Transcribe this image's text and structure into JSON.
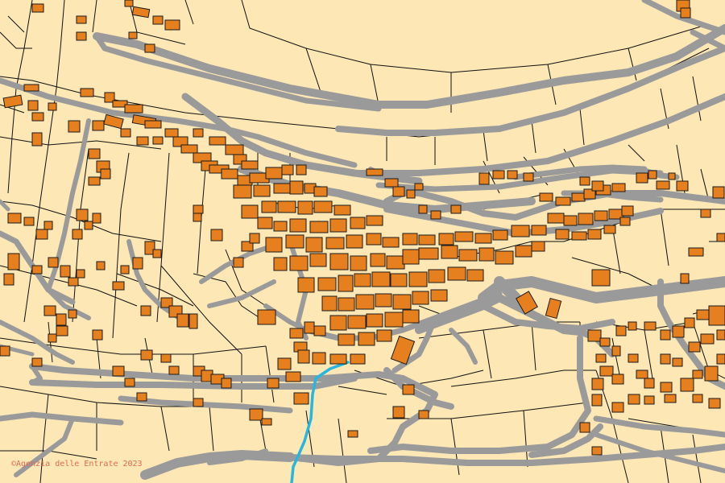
{
  "map": {
    "copyright_text": "Agenzia delle Entrate 2023",
    "copyright_symbol": "©",
    "colors": {
      "background": "#FCE7B5",
      "buildings": "#E6801E",
      "roads": "#9A9A9A",
      "parcel_lines": "#111111",
      "stream": "#25B7E0",
      "copyright": "#E06A55"
    }
  }
}
